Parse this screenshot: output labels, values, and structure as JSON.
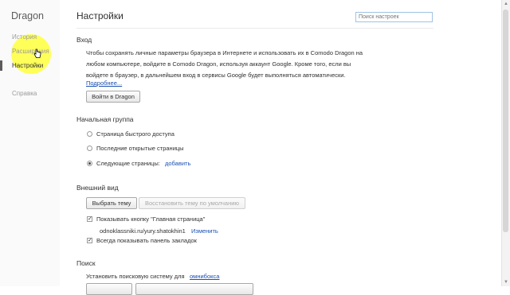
{
  "sidebar": {
    "brand": "Dragon",
    "items": [
      {
        "label": "История"
      },
      {
        "label": "Расширения"
      },
      {
        "label": "Настройки"
      },
      {
        "label": "Справка"
      }
    ]
  },
  "header": {
    "title": "Настройки",
    "search_placeholder": "Поиск настроек"
  },
  "signin": {
    "title": "Вход",
    "lines": [
      "Чтобы сохранять личные параметры браузера в Интернете и использовать их в Comodo Dragon на",
      "любом компьютере, войдите в Comodo Dragon, используя аккаунт Google. Кроме того, если вы",
      "войдете в браузер, в дальнейшем вход в сервисы Google будет выполняться автоматически."
    ],
    "more_link": "Подробнее...",
    "button": "Войти в Dragon"
  },
  "startup": {
    "title": "Начальная группа",
    "options": [
      {
        "label": "Страница быстрого доступа"
      },
      {
        "label": "Последние открытые страницы"
      },
      {
        "label": "Следующие страницы:"
      }
    ],
    "add_link": "добавить"
  },
  "appearance": {
    "title": "Внешний вид",
    "choose_theme": "Выбрать тему",
    "reset_theme": "Восстановить тему по умолчанию",
    "home_checkbox": "Показывать кнопку \"Главная страница\"",
    "home_url": "odnoklassniki.ru/yury.shatokhin1",
    "change_link": "Изменить",
    "bookmarks_checkbox": "Всегда показывать панель закладок"
  },
  "search": {
    "title": "Поиск",
    "text": "Установить поисковую систему для",
    "omnibox_link": "омнибокса"
  }
}
